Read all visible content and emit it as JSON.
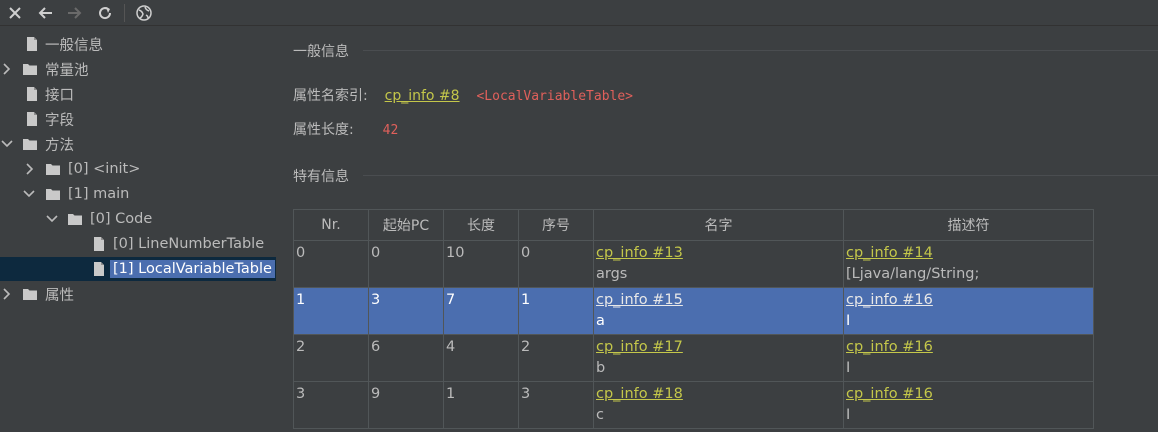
{
  "toolbar": {
    "buttons": [
      {
        "icon": "close-icon",
        "glyph": "✕"
      },
      {
        "icon": "back-arrow-icon",
        "glyph": "←"
      },
      {
        "icon": "forward-arrow-icon",
        "glyph": "→"
      },
      {
        "icon": "refresh-icon",
        "glyph": "⟳"
      },
      {
        "icon": "globe-icon",
        "glyph": "🌐"
      }
    ]
  },
  "tree": {
    "items": [
      {
        "label": "一般信息",
        "type": "file",
        "expanded": null
      },
      {
        "label": "常量池",
        "type": "folder",
        "expanded": false
      },
      {
        "label": "接口",
        "type": "file",
        "expanded": null
      },
      {
        "label": "字段",
        "type": "file",
        "expanded": null
      },
      {
        "label": "方法",
        "type": "folder",
        "expanded": true
      },
      {
        "label": "[0] <init>",
        "type": "folder",
        "expanded": false
      },
      {
        "label": "[1] main",
        "type": "folder",
        "expanded": true
      },
      {
        "label": "[0] Code",
        "type": "folder",
        "expanded": true
      },
      {
        "label": "[0] LineNumberTable",
        "type": "file",
        "expanded": null
      },
      {
        "label": "[1] LocalVariableTable",
        "type": "file",
        "expanded": null,
        "selected": true
      },
      {
        "label": "属性",
        "type": "folder",
        "expanded": false
      }
    ]
  },
  "general": {
    "title": "一般信息",
    "name_index_label": "属性名索引:",
    "name_index_link": "cp_info #8",
    "name_index_value": "<LocalVariableTable>",
    "length_label": "属性长度:",
    "length_value": "42"
  },
  "specific": {
    "title": "特有信息"
  },
  "table": {
    "columns": [
      "Nr.",
      "起始PC",
      "长度",
      "序号",
      "名字",
      "描述符"
    ],
    "rows": [
      {
        "nr": "0",
        "start_pc": "0",
        "length": "10",
        "index": "0",
        "name_link": "cp_info #13",
        "name": "args",
        "desc_link": "cp_info #14",
        "desc": "[Ljava/lang/String;",
        "selected": false
      },
      {
        "nr": "1",
        "start_pc": "3",
        "length": "7",
        "index": "1",
        "name_link": "cp_info #15",
        "name": "a",
        "desc_link": "cp_info #16",
        "desc": "I",
        "selected": true
      },
      {
        "nr": "2",
        "start_pc": "6",
        "length": "4",
        "index": "2",
        "name_link": "cp_info #17",
        "name": "b",
        "desc_link": "cp_info #16",
        "desc": "I",
        "selected": false
      },
      {
        "nr": "3",
        "start_pc": "9",
        "length": "1",
        "index": "3",
        "name_link": "cp_info #18",
        "name": "c",
        "desc_link": "cp_info #16",
        "desc": "I",
        "selected": false
      }
    ]
  },
  "colors": {
    "background": "#3c3f41",
    "selection": "#4b6eaf",
    "link": "#c4c74a",
    "value_red": "#e0605b"
  }
}
